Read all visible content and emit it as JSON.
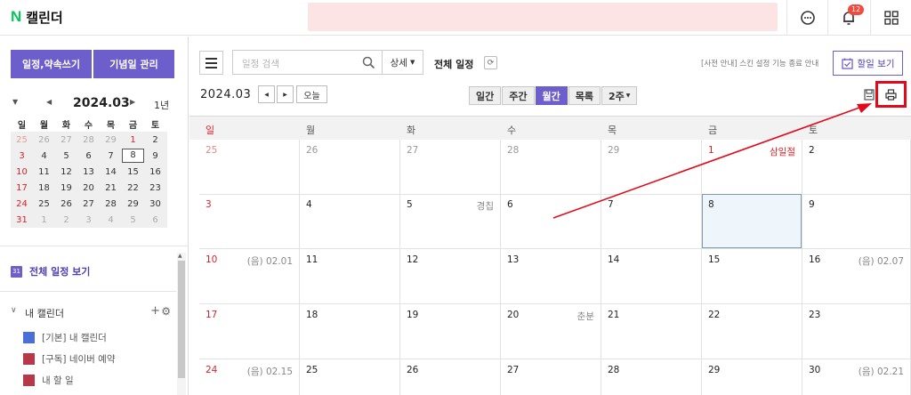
{
  "header": {
    "logo_letter": "N",
    "app_title": "캘린더",
    "notification_count": "12"
  },
  "sidebar": {
    "new_event_button": "일정,약속쓰기",
    "anniversary_button": "기념일 관리",
    "mini_calendar": {
      "title": "2024.03",
      "year_label": "1년",
      "weekdays": [
        "일",
        "월",
        "화",
        "수",
        "목",
        "금",
        "토"
      ],
      "weeks": [
        [
          "25",
          "26",
          "27",
          "28",
          "29",
          "1",
          "2"
        ],
        [
          "3",
          "4",
          "5",
          "6",
          "7",
          "8",
          "9"
        ],
        [
          "10",
          "11",
          "12",
          "13",
          "14",
          "15",
          "16"
        ],
        [
          "17",
          "18",
          "19",
          "20",
          "21",
          "22",
          "23"
        ],
        [
          "24",
          "25",
          "26",
          "27",
          "28",
          "29",
          "30"
        ],
        [
          "31",
          "1",
          "2",
          "3",
          "4",
          "5",
          "6"
        ]
      ]
    },
    "all_events_icon": "31",
    "all_events_label": "전체 일정 보기",
    "my_calendar_label": "내 캘린더",
    "calendars": [
      {
        "label": "[기본] 내 캘린더",
        "color": "#4a6fd8"
      },
      {
        "label": "[구독] 네이버 예약",
        "color": "#b8384a"
      },
      {
        "label": "내 할 일",
        "color": "#b8384a"
      }
    ]
  },
  "toolbar": {
    "search_placeholder": "일정 검색",
    "detail_label": "상세",
    "all_events_title": "전체 일정",
    "notice": "[사전 안내] 스킨 설정 기능 종료 안내",
    "todo_button": "할일 보기",
    "current_month": "2024.03",
    "today_button": "오늘",
    "views": [
      "일간",
      "주간",
      "월간",
      "목록",
      "2주"
    ],
    "active_view": "월간"
  },
  "calendar": {
    "weekdays": [
      "일",
      "월",
      "화",
      "수",
      "목",
      "금",
      "토"
    ],
    "weeks": [
      [
        {
          "d": "25"
        },
        {
          "d": "26"
        },
        {
          "d": "27"
        },
        {
          "d": "28"
        },
        {
          "d": "29"
        },
        {
          "d": "1",
          "note": "삼일절"
        },
        {
          "d": "2"
        }
      ],
      [
        {
          "d": "3"
        },
        {
          "d": "4"
        },
        {
          "d": "5",
          "note": "경칩"
        },
        {
          "d": "6"
        },
        {
          "d": "7"
        },
        {
          "d": "8"
        },
        {
          "d": "9"
        }
      ],
      [
        {
          "d": "10",
          "note": "(음) 02.01"
        },
        {
          "d": "11"
        },
        {
          "d": "12"
        },
        {
          "d": "13"
        },
        {
          "d": "14"
        },
        {
          "d": "15"
        },
        {
          "d": "16",
          "note": "(음) 02.07"
        }
      ],
      [
        {
          "d": "17"
        },
        {
          "d": "18"
        },
        {
          "d": "19"
        },
        {
          "d": "20",
          "note": "춘분"
        },
        {
          "d": "21"
        },
        {
          "d": "22"
        },
        {
          "d": "23"
        }
      ],
      [
        {
          "d": "24",
          "note": "(음) 02.15"
        },
        {
          "d": "25"
        },
        {
          "d": "26"
        },
        {
          "d": "27"
        },
        {
          "d": "28"
        },
        {
          "d": "29"
        },
        {
          "d": "30",
          "note": "(음) 02.21"
        }
      ]
    ]
  },
  "colors": {
    "accent": "#6d5fcb",
    "holiday": "#d8232a",
    "highlight_annotation": "#e3081a"
  }
}
